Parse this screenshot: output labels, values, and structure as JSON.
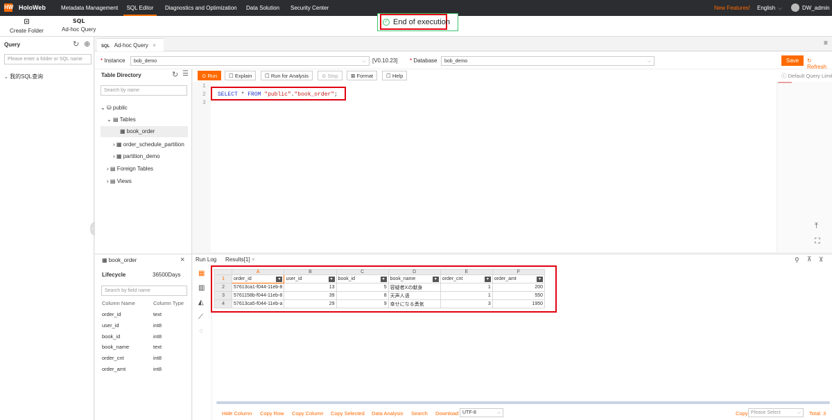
{
  "nav": {
    "logo": "HW",
    "brand": "HoloWeb",
    "items": [
      "Metadata Management",
      "SQL Editor",
      "Diagnostics and Optimization",
      "Data Solution",
      "Security Center"
    ],
    "new_features": "New Features!",
    "language": "English",
    "user": "DW_admin"
  },
  "toolbar": {
    "create_folder": "Create Folder",
    "adhoc_query": "Ad-hoc Query",
    "sql_icon": "SQL"
  },
  "notice": {
    "text": "End of execution"
  },
  "left": {
    "title": "Query",
    "search_placeholder": "Please enter a folder or SQL name",
    "my_sql": "我的SQL查询"
  },
  "tab": {
    "prefix": "SQL",
    "label": "Ad-hoc Query"
  },
  "instance": {
    "label": "Instance",
    "value": "bob_demo",
    "version": "[V0.10.23]",
    "db_label": "Database",
    "db_value": "bob_demo",
    "save": "Save",
    "refresh": "Refresh"
  },
  "table_dir": {
    "title": "Table Directory",
    "search_placeholder": "Search by name",
    "schema": "public",
    "tables_label": "Tables",
    "tables": [
      "book_order",
      "order_schedule_partition",
      "partition_demo"
    ],
    "foreign": "Foreign Tables",
    "views": "Views"
  },
  "editor": {
    "buttons": {
      "run": "Run",
      "explain": "Explain",
      "analysis": "Run for Analysis",
      "stop": "Stop",
      "format": "Format",
      "help": "Help"
    },
    "default_limit": "Default Query Limit",
    "lines": [
      "1",
      "2",
      "3"
    ],
    "code": {
      "select": "SELECT",
      "star": "*",
      "from": "FROM",
      "schema": "\"public\"",
      "dot": ".",
      "table": "\"book_order\"",
      "semi": ";"
    }
  },
  "colpanel": {
    "table": "book_order",
    "lifecycle_label": "Lifecycle",
    "lifecycle_value": "36500Days",
    "search_placeholder": "Search by field name",
    "col_name_hdr": "Column Name",
    "col_type_hdr": "Column Type",
    "columns": [
      {
        "name": "order_id",
        "type": "text"
      },
      {
        "name": "user_id",
        "type": "int8"
      },
      {
        "name": "book_id",
        "type": "int8"
      },
      {
        "name": "book_name",
        "type": "text"
      },
      {
        "name": "order_cnt",
        "type": "int8"
      },
      {
        "name": "order_amt",
        "type": "int8"
      }
    ]
  },
  "results": {
    "run_log": "Run Log",
    "results_tab": "Results[1]",
    "letters": [
      "A",
      "B",
      "C",
      "D",
      "E",
      "F"
    ],
    "headers": [
      "order_id",
      "user_id",
      "book_id",
      "book_name",
      "order_cnt",
      "order_amt"
    ],
    "rows": [
      [
        "57613ca1-f044-11eb-8",
        "13",
        "5",
        "容疑者Xの献身",
        "1",
        "200"
      ],
      [
        "5761158b-f044-11eb-8",
        "39",
        "8",
        "天声人语",
        "1",
        "550"
      ],
      [
        "57613ca5-f044-11eb-a",
        "29",
        "9",
        "幸せになる勇気",
        "3",
        "1950"
      ]
    ],
    "footer": {
      "links": [
        "Hide Column",
        "Copy Row",
        "Copy Column",
        "Copy Selected",
        "Data Analysis",
        "Search",
        "Download"
      ],
      "encoding": "UTF-8",
      "copy": "Copy",
      "copy_select": "Please Select",
      "total": "Total: 3"
    }
  },
  "colors": {
    "accent": "#ff6a00",
    "nav_bg": "#2b2d30",
    "highlight": "#e00010"
  }
}
